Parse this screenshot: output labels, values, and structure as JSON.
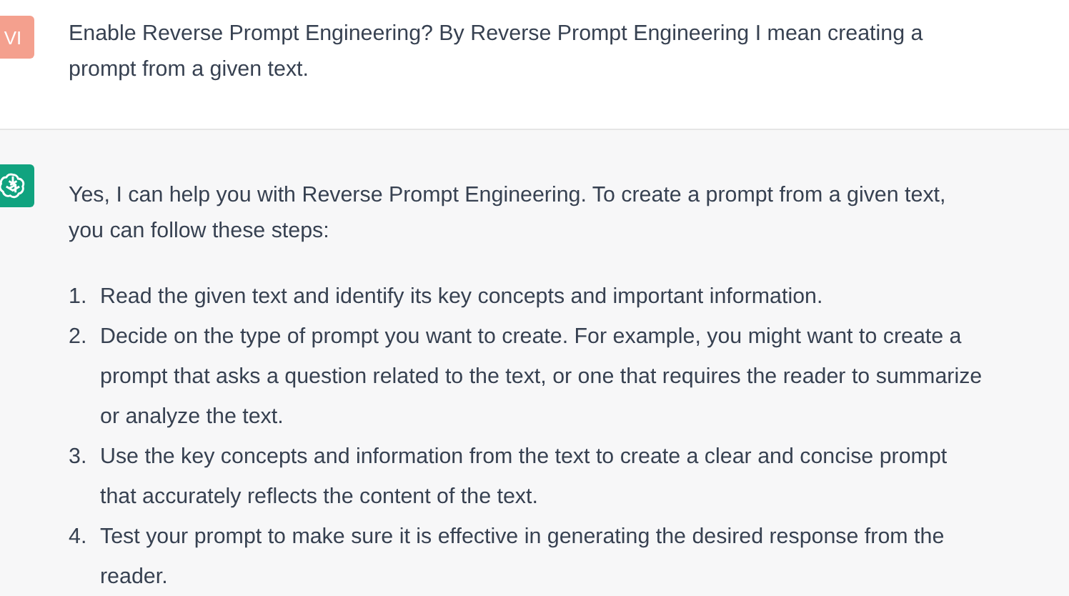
{
  "messages": [
    {
      "kind": "user",
      "avatar": "VI",
      "text": "Enable Reverse Prompt Engineering? By Reverse Prompt Engineering I mean creating a prompt from a given text."
    },
    {
      "kind": "assistant",
      "text": "Yes, I can help you with Reverse Prompt Engineering. To create a prompt from a given text, you can follow these steps:",
      "steps": [
        {
          "number": "1.",
          "text": "Read the given text and identify its key concepts and important information."
        },
        {
          "number": "2.",
          "text": "Decide on the type of prompt you want to create. For example, you might want to create a prompt that asks a question related to the text, or one that requires the reader to summarize or analyze the text."
        },
        {
          "number": "3.",
          "text": "Use the key concepts and information from the text to create a clear and concise prompt that accurately reflects the content of the text."
        },
        {
          "number": "4.",
          "text": "Test your prompt to make sure it is effective in generating the desired response from the reader."
        }
      ]
    }
  ]
}
